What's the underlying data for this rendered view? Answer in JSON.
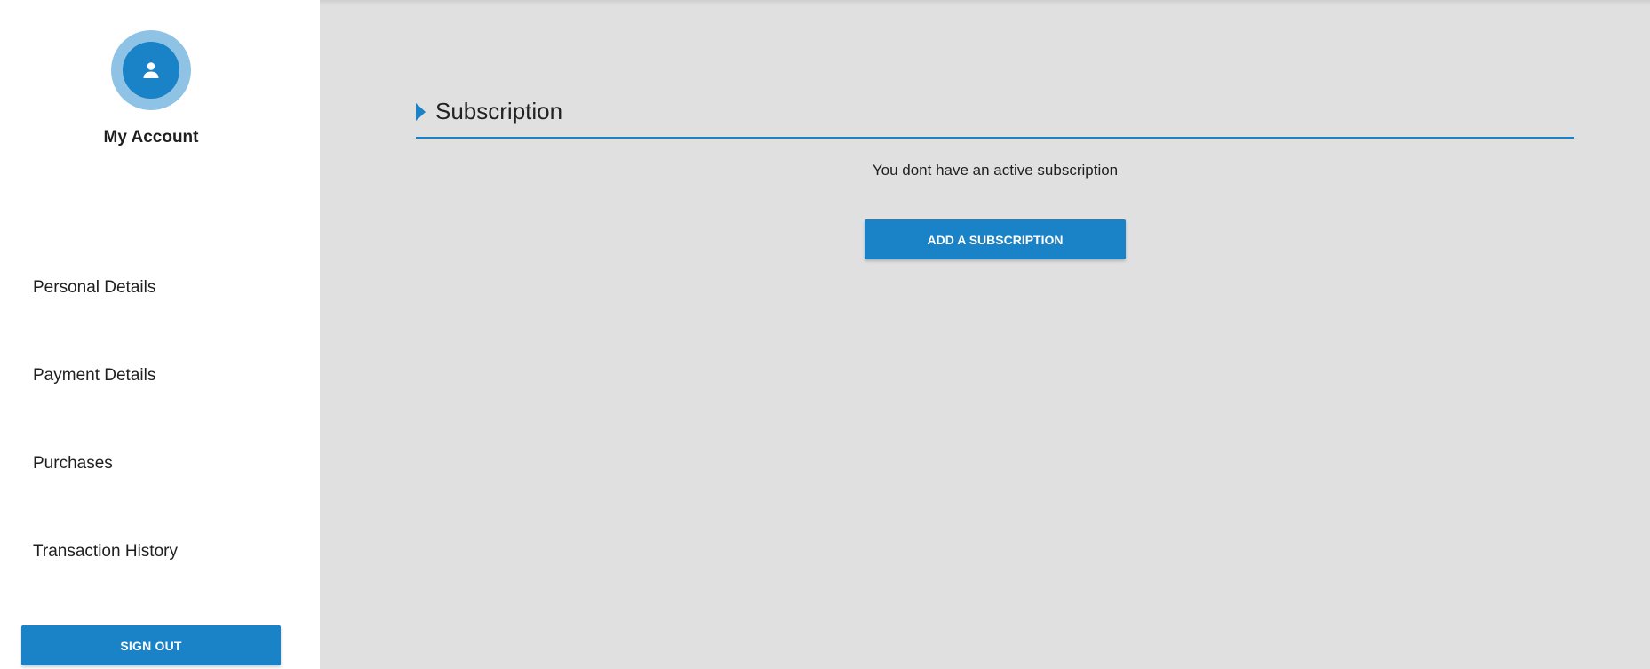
{
  "colors": {
    "accent": "#1a82c6",
    "avatar_ring": "#8ec3e6",
    "content_bg": "#e0e0e0",
    "sidebar_bg": "#ffffff"
  },
  "sidebar": {
    "avatar_icon": "person-icon",
    "title": "My Account",
    "items": [
      {
        "label": "Personal Details"
      },
      {
        "label": "Payment Details"
      },
      {
        "label": "Purchases"
      },
      {
        "label": "Transaction History"
      }
    ],
    "sign_out_label": "SIGN OUT"
  },
  "main": {
    "section_title": "Subscription",
    "empty_message": "You dont have an active subscription",
    "add_button_label": "ADD A SUBSCRIPTION"
  }
}
